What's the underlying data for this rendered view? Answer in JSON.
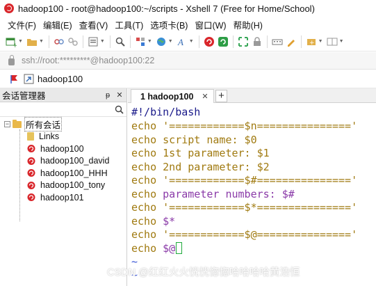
{
  "window": {
    "title": "hadoop100 - root@hadoop100:~/scripts - Xshell 7 (Free for Home/School)"
  },
  "menu": [
    {
      "label": "文件(F)"
    },
    {
      "label": "编辑(E)"
    },
    {
      "label": "查看(V)"
    },
    {
      "label": "工具(T)"
    },
    {
      "label": "选项卡(B)"
    },
    {
      "label": "窗口(W)"
    },
    {
      "label": "帮助(H)"
    }
  ],
  "toolbar_icons": [
    "new-session-icon",
    "open-folder-icon",
    "connect-icon",
    "disconnect-icon",
    "properties-icon",
    "find-icon",
    "transfer-icon",
    "globe-icon",
    "font-icon",
    "xshell-icon",
    "xftp-icon",
    "fullscreen-icon",
    "lock-icon",
    "keyboard-icon",
    "highlight-icon",
    "compose-icon",
    "layout-icon"
  ],
  "address": {
    "text": "ssh://root:*********@hadoop100:22"
  },
  "session_bar": {
    "name": "hadoop100"
  },
  "session_manager": {
    "title": "会话管理器",
    "pin": "ᵽ",
    "close": "✕",
    "tree": [
      {
        "label": "所有会话",
        "type": "root-folder",
        "expanded": true
      },
      {
        "label": "Links",
        "type": "folder"
      },
      {
        "label": "hadoop100",
        "type": "session"
      },
      {
        "label": "hadoop100_david",
        "type": "session"
      },
      {
        "label": "hadoop100_HHH",
        "type": "session"
      },
      {
        "label": "hadoop100_tony",
        "type": "session"
      },
      {
        "label": "hadoop101",
        "type": "session"
      }
    ]
  },
  "tabs": [
    {
      "label": "1 hadoop100",
      "active": true
    }
  ],
  "terminal": {
    "shebang": "#!/bin/bash",
    "lines": [
      {
        "cmd": "echo",
        "str": "'============$n==============='"
      },
      {
        "cmd": "echo",
        "str": "script name: $0"
      },
      {
        "cmd": "echo",
        "str": "1st parameter: $1"
      },
      {
        "cmd": "echo",
        "str": "2nd parameter: $2"
      },
      {
        "cmd": "echo",
        "str": "'============$#==============='"
      },
      {
        "cmd": "echo",
        "str": "parameter numbers: $#"
      },
      {
        "cmd": "echo",
        "str": "'============$*==============='"
      },
      {
        "cmd": "echo",
        "str": "$*"
      },
      {
        "cmd": "echo",
        "str": "'============$@==============='"
      },
      {
        "cmd": "echo",
        "str": "$@"
      }
    ],
    "tilde_1": "~",
    "tilde_2": "~"
  },
  "watermark": "CSDN @红红火火恍恍惚惚哈哈哈哈黄浩恒",
  "colors": {
    "brand_red": "#d9262b",
    "term_keyword": "#a07a10",
    "term_shebang": "#1a1a8a",
    "term_tilde": "#3a56d6",
    "cursor": "#1faa3c"
  }
}
